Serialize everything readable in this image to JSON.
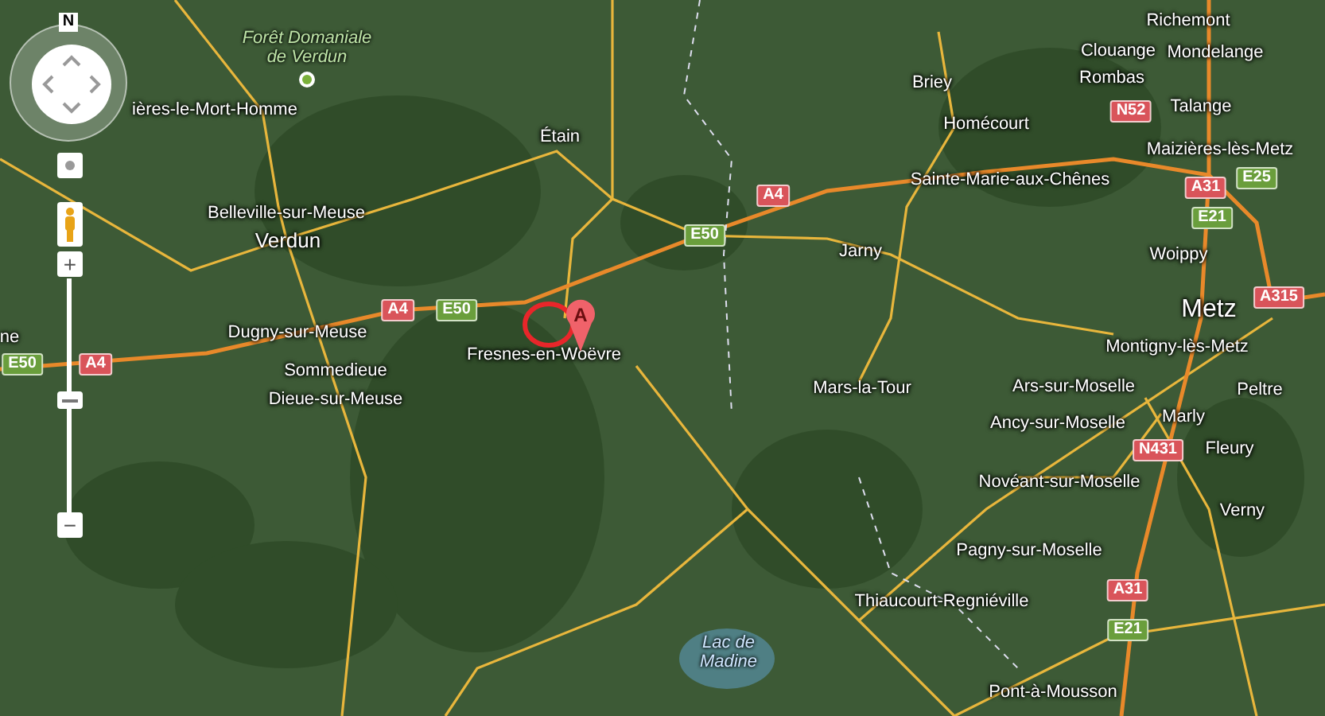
{
  "map_controls": {
    "compass_label": "N",
    "zoom_in": "+",
    "zoom_out": "−",
    "zoom_slider": {
      "level": 0.48
    }
  },
  "marker": {
    "label": "A"
  },
  "places": [
    {
      "name": "Forêt Domaniale de Verdun",
      "kind": "forest"
    },
    {
      "name": "ières-le-Mort-Homme",
      "kind": "town"
    },
    {
      "name": "Étain",
      "kind": "town"
    },
    {
      "name": "Briey",
      "kind": "town"
    },
    {
      "name": "Richemont",
      "kind": "town"
    },
    {
      "name": "Clouange",
      "kind": "town"
    },
    {
      "name": "Mondelange",
      "kind": "town"
    },
    {
      "name": "Rombas",
      "kind": "town"
    },
    {
      "name": "Talange",
      "kind": "town"
    },
    {
      "name": "Homécourt",
      "kind": "town"
    },
    {
      "name": "Maizières-lès-Metz",
      "kind": "town"
    },
    {
      "name": "Sainte-Marie-aux-Chênes",
      "kind": "town"
    },
    {
      "name": "Belleville-sur-Meuse",
      "kind": "town"
    },
    {
      "name": "Verdun",
      "kind": "city"
    },
    {
      "name": "Jarny",
      "kind": "town"
    },
    {
      "name": "Woippy",
      "kind": "town"
    },
    {
      "name": "Metz",
      "kind": "bigcity"
    },
    {
      "name": "ne",
      "kind": "town"
    },
    {
      "name": "Dugny-sur-Meuse",
      "kind": "town"
    },
    {
      "name": "Fresnes-en-Woëvre",
      "kind": "town"
    },
    {
      "name": "Mars-la-Tour",
      "kind": "town"
    },
    {
      "name": "Montigny-lès-Metz",
      "kind": "town"
    },
    {
      "name": "Sommedieue",
      "kind": "town"
    },
    {
      "name": "Ars-sur-Moselle",
      "kind": "town"
    },
    {
      "name": "Peltre",
      "kind": "town"
    },
    {
      "name": "Dieue-sur-Meuse",
      "kind": "town"
    },
    {
      "name": "Marly",
      "kind": "town"
    },
    {
      "name": "Ancy-sur-Moselle",
      "kind": "town"
    },
    {
      "name": "Fleury",
      "kind": "town"
    },
    {
      "name": "Novéant-sur-Moselle",
      "kind": "town"
    },
    {
      "name": "Verny",
      "kind": "town"
    },
    {
      "name": "Pagny-sur-Moselle",
      "kind": "town"
    },
    {
      "name": "Thiaucourt-Regniéville",
      "kind": "town"
    },
    {
      "name": "Lac de Madine",
      "kind": "water"
    },
    {
      "name": "Pont-à-Mousson",
      "kind": "town"
    }
  ],
  "road_shields": [
    {
      "label": "N52",
      "kind": "national"
    },
    {
      "label": "A31",
      "kind": "motorway"
    },
    {
      "label": "E25",
      "kind": "european"
    },
    {
      "label": "E21",
      "kind": "european"
    },
    {
      "label": "A4",
      "kind": "motorway"
    },
    {
      "label": "E50",
      "kind": "european"
    },
    {
      "label": "A315",
      "kind": "motorway"
    },
    {
      "label": "A4",
      "kind": "motorway"
    },
    {
      "label": "E50",
      "kind": "european"
    },
    {
      "label": "E50",
      "kind": "european"
    },
    {
      "label": "A4",
      "kind": "motorway"
    },
    {
      "label": "N431",
      "kind": "national"
    },
    {
      "label": "A31",
      "kind": "motorway"
    },
    {
      "label": "E21",
      "kind": "european"
    }
  ]
}
